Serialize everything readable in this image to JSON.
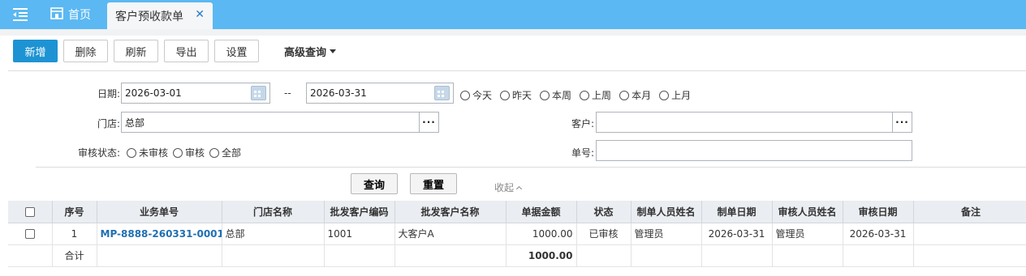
{
  "tabs": {
    "home": "首页",
    "active": "客户预收款单"
  },
  "toolbar": {
    "add": "新增",
    "delete": "删除",
    "refresh": "刷新",
    "export": "导出",
    "settings": "设置",
    "advanced": "高级查询"
  },
  "filters": {
    "date_label": "日期:",
    "date_from": "2026-03-01",
    "date_sep": "--",
    "date_to": "2026-03-31",
    "quick_dates": [
      "今天",
      "昨天",
      "本周",
      "上周",
      "本月",
      "上月"
    ],
    "store_label": "门店:",
    "store_value": "总部",
    "customer_label": "客户:",
    "customer_value": "",
    "status_label": "审核状态:",
    "status_options": [
      "未审核",
      "审核",
      "全部"
    ],
    "docno_label": "单号:",
    "docno_value": "",
    "query": "查询",
    "reset": "重置",
    "collapse": "收起"
  },
  "grid": {
    "columns": [
      "序号",
      "业务单号",
      "门店名称",
      "批发客户编码",
      "批发客户名称",
      "单据金额",
      "状态",
      "制单人员姓名",
      "制单日期",
      "审核人员姓名",
      "审核日期",
      "备注"
    ],
    "rows": [
      {
        "no": "1",
        "doc": "MP-8888-260331-0001",
        "store": "总部",
        "cust_code": "1001",
        "cust_name": "大客户A",
        "amount": "1000.00",
        "status": "已审核",
        "maker": "管理员",
        "make_date": "2026-03-31",
        "auditor": "管理员",
        "audit_date": "2026-03-31",
        "remark": ""
      }
    ],
    "total_label": "合计",
    "total_amount": "1000.00"
  },
  "colors": {
    "topbar": "#5bb8f2",
    "primary": "#1e93d3",
    "link": "#1f6fb2"
  }
}
